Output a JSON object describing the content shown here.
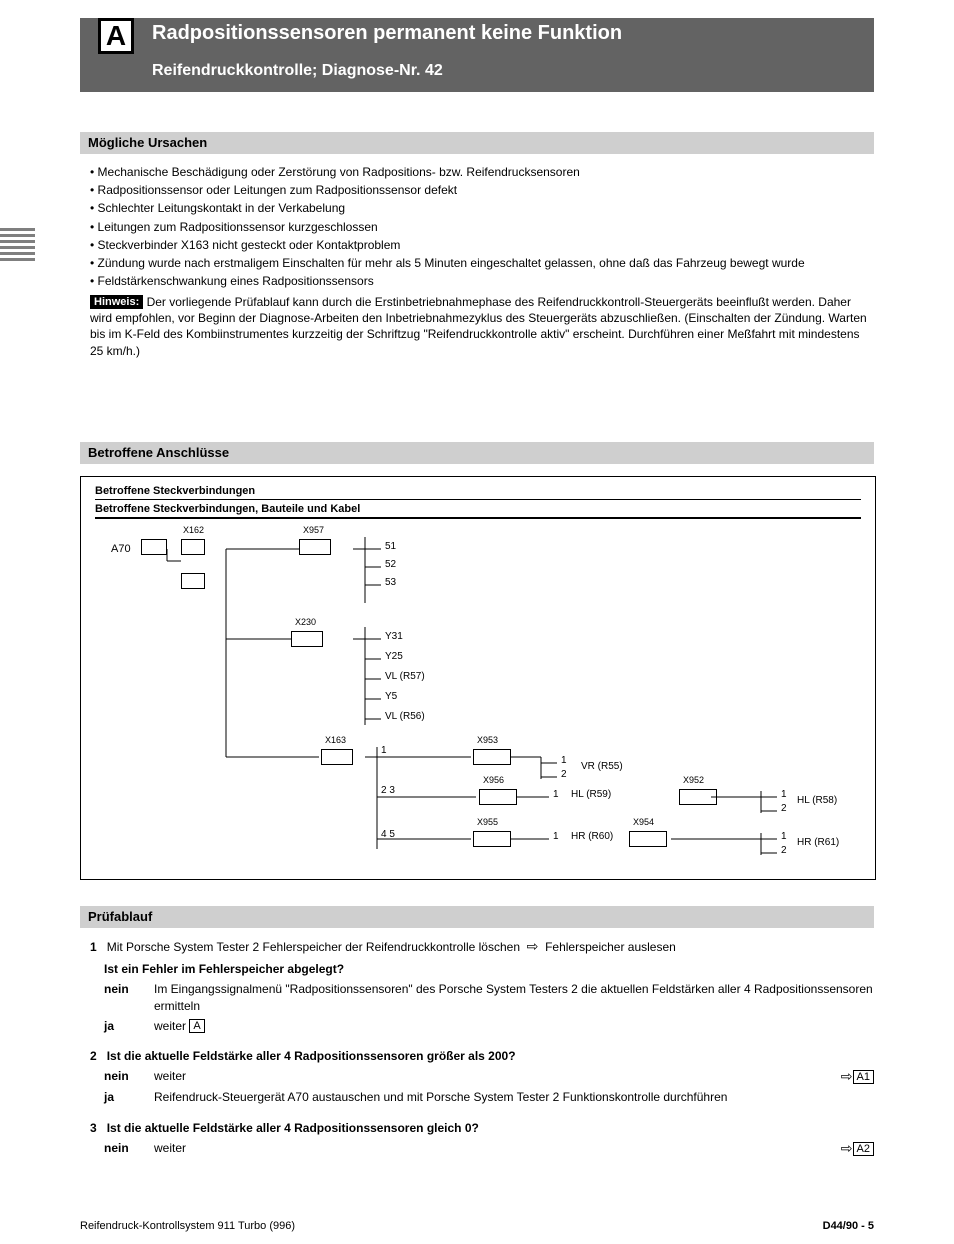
{
  "banner": {
    "letter": "A",
    "title": "Radpositionssensoren permanent keine Funktion",
    "sub": "Reifendruckkontrolle; Diagnose-Nr. 42"
  },
  "section1": "Mögliche Ursachen",
  "causes": [
    "Mechanische Beschädigung oder Zerstörung von Radpositions- bzw. Reifendrucksensoren",
    "Radpositionssensor oder Leitungen zum Radpositionssensor defekt",
    "Schlechter Leitungskontakt in der Verkabelung",
    "Leitungen zum Radpositionssensor kurzgeschlossen",
    "Steckverbinder X163 nicht gesteckt oder Kontaktproblem",
    "Zündung wurde nach erstmaligem Einschalten für mehr als 5 Minuten eingeschaltet gelassen, ohne daß das Fahrzeug bewegt wurde",
    "Feldstärkenschwankung eines Radpositionssensors"
  ],
  "note_label": "Hinweis:",
  "note_body": "Der vorliegende Prüfablauf kann durch die Erstinbetriebnahmephase des Reifendruckkontroll-Steuergeräts beeinflußt werden. Daher wird empfohlen, vor Beginn der Diagnose-Arbeiten den Inbetriebnahmezyklus des Steuergeräts abzuschließen. (Einschalten der Zündung. Warten bis im K-Feld des Kombiinstrumentes kurzzeitig der Schriftzug \"Reifendruckkontrolle aktiv\" erscheint. Durchführen einer Meßfahrt mit mindestens 25 km/h.)",
  "section2": "Betroffene Anschlüsse",
  "diag_head_left": "Betroffene Steckverbindungen",
  "diag_head_right": "Betroffene Steckverbindungen, Bauteile und Kabel",
  "diag": {
    "a70": "A70",
    "x162": "X162",
    "x957": "X957",
    "x957_pins": [
      "51",
      "52",
      "53"
    ],
    "x230": "X230",
    "x230_pins": [
      "Y31",
      "Y25",
      "VL (R57)",
      "Y5",
      "VL (R56)"
    ],
    "x163": "X163",
    "x163_pins": [
      "1",
      "2",
      "3",
      "4",
      "5"
    ],
    "x953": "X953",
    "x953_pins": [
      "1",
      "2"
    ],
    "x956": "X956",
    "x956_pin": "1",
    "x955": "X955",
    "x955_pin": "1",
    "x952": "X952",
    "x952_pins": [
      "1",
      "2"
    ],
    "x954": "X954",
    "x954_pins": [
      "1",
      "2"
    ],
    "vr": "VR (R55)",
    "hl": "HL (R59)",
    "hl2": "HL (R58)",
    "hr": "HR (R60)",
    "hr2": "HR (R61)"
  },
  "section3": "Prüfablauf",
  "test": {
    "line1a": "Mit Porsche System Tester 2 Fehlerspeicher der Reifendruckkontrolle löschen",
    "arrow1": "⇨",
    "line1b": "Fehlerspeicher auslesen",
    "q1": "Ist ein Fehler im Fehlerspeicher abgelegt?",
    "yes": "ja",
    "no": "nein",
    "line2": "Im Eingangssignalmenü \"Radpositionssensoren\" des Porsche System Testers 2 die aktuellen Feldstärken aller 4 Radpositionssensoren ermitteln",
    "yes_cont": "weiter",
    "letterA": "A",
    "q2": "Ist die aktuelle Feldstärke aller 4 Radpositionssensoren größer als 200?",
    "routeA1": "A1",
    "r2": "Reifendruck-Steuergerät A70 austauschen und mit Porsche System Tester 2 Funktionskontrolle durchführen",
    "q3": "Ist die aktuelle Feldstärke aller 4 Radpositionssensoren gleich 0?",
    "routeA2": "A2"
  },
  "footer_left": "Reifendruck-Kontrollsystem 911 Turbo (996)",
  "footer_right": "D44/90 - 5"
}
